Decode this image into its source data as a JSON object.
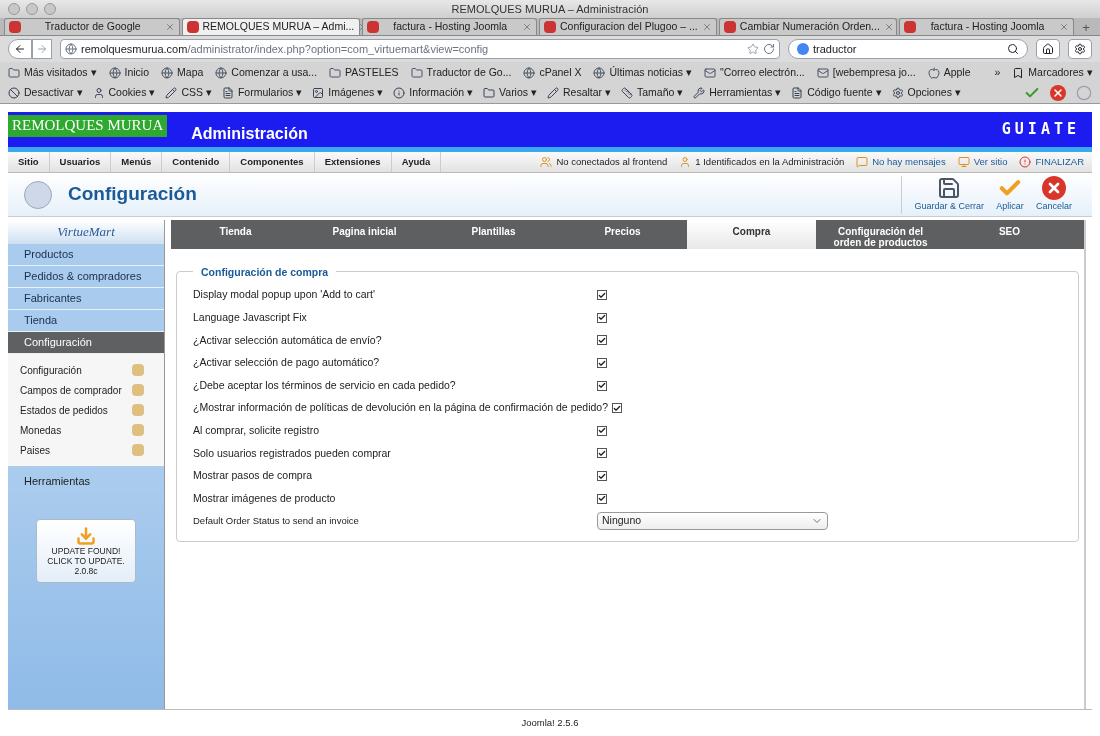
{
  "window": {
    "title": "REMOLQUES MURUA – Administración"
  },
  "browser_tabs": [
    {
      "label": "Traductor de Google",
      "selected": false
    },
    {
      "label": "REMOLQUES MURUA – Admi...",
      "selected": true
    },
    {
      "label": "factura - Hosting Joomla",
      "selected": false
    },
    {
      "label": "Configuracion del Plugoo – ...",
      "selected": false
    },
    {
      "label": "Cambiar Numeración Orden...",
      "selected": false
    },
    {
      "label": "factura - Hosting Joomla",
      "selected": false
    }
  ],
  "new_tab": "+",
  "address_bar": {
    "host": "remolquesmurua.com",
    "path": "/administrator/index.php?option=com_virtuemart&view=config"
  },
  "search": {
    "value": "traductor"
  },
  "bookmarks": [
    "Más visitados ▾",
    "Inicio",
    "Mapa",
    "Comenzar a usa...",
    "PASTELES",
    "Traductor de Go...",
    "cPanel X",
    "Últimas noticias ▾",
    "\"Correo electrón...",
    "[webempresa jo...",
    "Apple"
  ],
  "bookmarks_more": "»",
  "bookmarks_menu": "Marcadores ▾",
  "dev_toolbar": [
    "Desactivar ▾",
    "Cookies ▾",
    "CSS ▾",
    "Formularios ▾",
    "Imágenes ▾",
    "Información ▾",
    "Varios ▾",
    "Resaltar ▾",
    "Tamaño ▾",
    "Herramientas ▾",
    "Código fuente ▾",
    "Opciones ▾"
  ],
  "site": {
    "brand": "REMOLQUES MURUA",
    "title": "Administración",
    "logo": "GUIATE"
  },
  "admin_menu": [
    "Sitio",
    "Usuarios",
    "Menús",
    "Contenido",
    "Componentes",
    "Extensiones",
    "Ayuda"
  ],
  "status_links": [
    "No conectados al frontend",
    "1 Identificados en la Administración",
    "No hay mensajes",
    "Ver sitio",
    "FINALIZAR"
  ],
  "page_title": "Configuración",
  "toolbar_buttons": [
    {
      "kind": "save",
      "label": "Guardar & Cerrar"
    },
    {
      "kind": "apply",
      "label": "Aplicar"
    },
    {
      "kind": "cancel",
      "label": "Cancelar"
    }
  ],
  "sidebar": {
    "brand": "VirtueMart",
    "sections": [
      {
        "label": "Productos",
        "selected": false
      },
      {
        "label": "Pedidos & compradores",
        "selected": false
      },
      {
        "label": "Fabricantes",
        "selected": false
      },
      {
        "label": "Tienda",
        "selected": false
      },
      {
        "label": "Configuración",
        "selected": true
      }
    ],
    "subitems": [
      "Configuración",
      "Campos de comprador",
      "Estados de pedidos",
      "Monedas",
      "Paises"
    ],
    "tools": "Herramientas",
    "update": [
      "UPDATE FOUND!",
      "CLICK TO UPDATE.",
      "2.0.8c"
    ]
  },
  "tabs": [
    {
      "label": "Tienda",
      "selected": false
    },
    {
      "label": "Pagina inicial",
      "selected": false
    },
    {
      "label": "Plantillas",
      "selected": false
    },
    {
      "label": "Precios",
      "selected": false
    },
    {
      "label": "Compra",
      "selected": true
    },
    {
      "label": "Configuración del orden de productos",
      "selected": false
    },
    {
      "label": "SEO",
      "selected": false
    }
  ],
  "fieldset": {
    "legend": "Configuración de compra",
    "rows": [
      {
        "kind": "checkbox",
        "label": "Display modal popup upon 'Add to cart'",
        "checked": true
      },
      {
        "kind": "checkbox",
        "label": "Language Javascript Fix",
        "checked": true
      },
      {
        "kind": "checkbox",
        "label": "¿Activar selección automática de envío?",
        "checked": true
      },
      {
        "kind": "checkbox",
        "label": "¿Activar selección de pago automático?",
        "checked": true
      },
      {
        "kind": "checkbox",
        "label": "¿Debe aceptar los términos de servicio en cada pedido?",
        "checked": true
      },
      {
        "kind": "checkbox",
        "label": "¿Mostrar información de políticas de devolución en la página de confirmación de pedido?",
        "checked": true
      },
      {
        "kind": "checkbox",
        "label": "Al comprar, solicite registro",
        "checked": true
      },
      {
        "kind": "checkbox",
        "label": "Solo usuarios registrados pueden comprar",
        "checked": true
      },
      {
        "kind": "checkbox",
        "label": "Mostrar pasos de compra",
        "checked": true
      },
      {
        "kind": "checkbox",
        "label": "Mostrar imágenes de producto",
        "checked": true
      },
      {
        "kind": "select",
        "label": "Default Order Status to send an invoice",
        "value": "Ninguno"
      }
    ]
  },
  "footer": "Joomla! 2.5.6"
}
